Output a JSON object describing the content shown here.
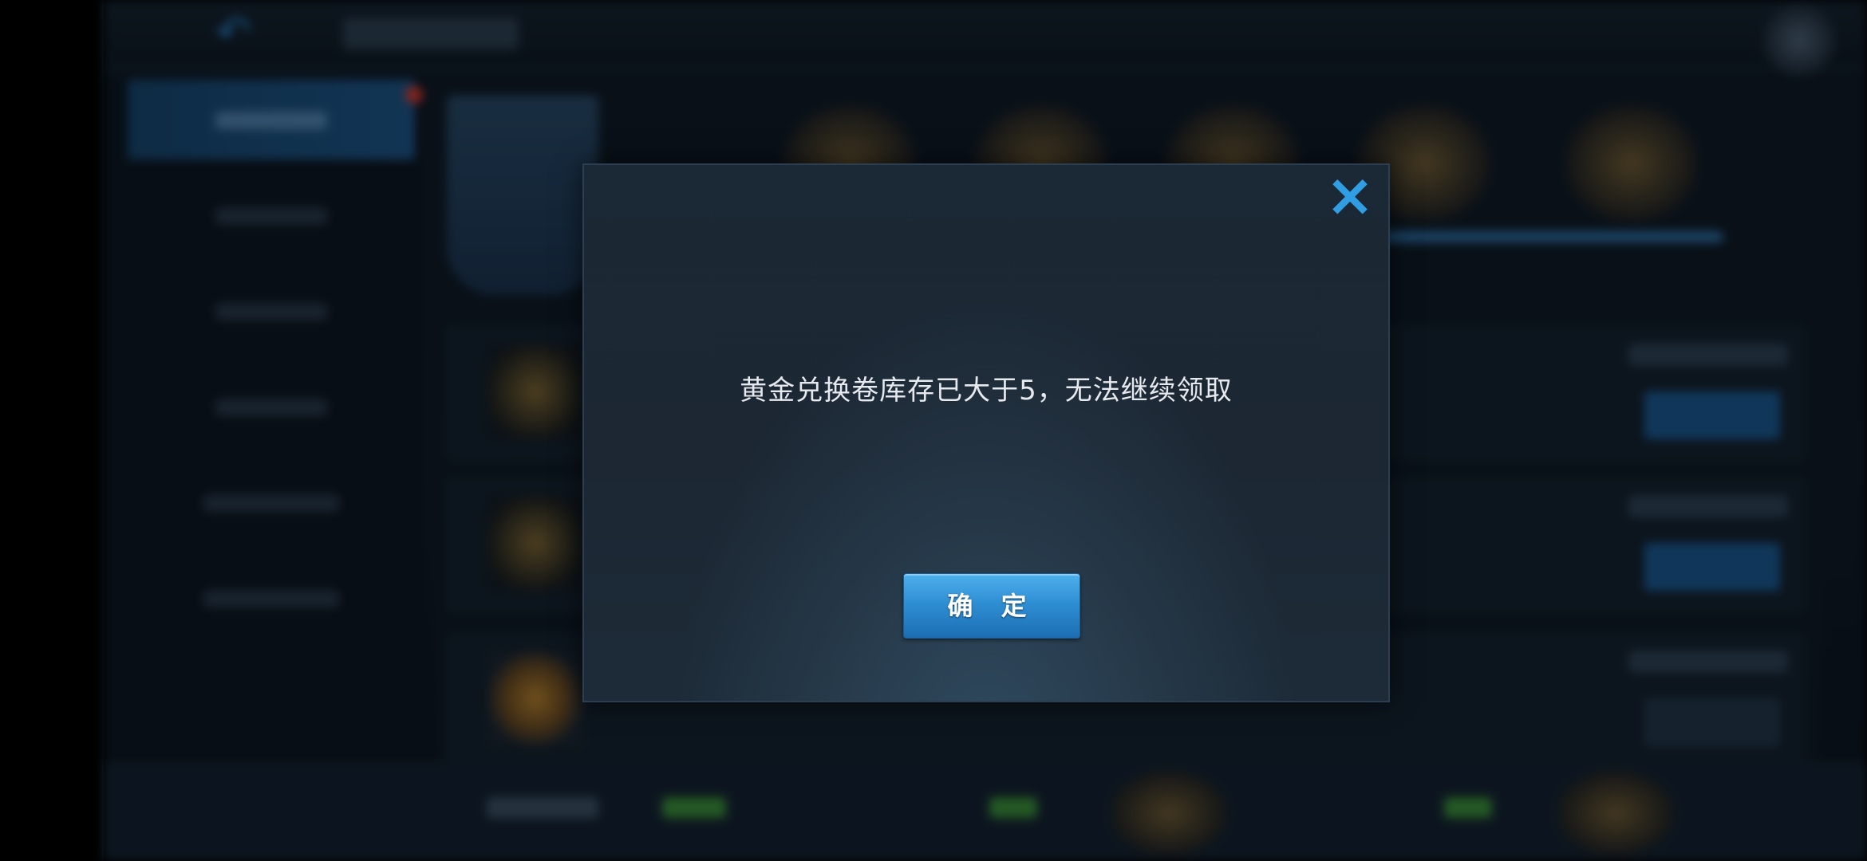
{
  "dialog": {
    "message": "黄金兑换卷库存已大于5，无法继续领取",
    "confirm_label": "确 定",
    "close_icon": "×"
  },
  "background": {
    "back_icon": "↶"
  },
  "colors": {
    "accent_blue": "#2f9ee3",
    "button_blue": "#2f8fd3",
    "dialog_bg": "#1c2733"
  }
}
